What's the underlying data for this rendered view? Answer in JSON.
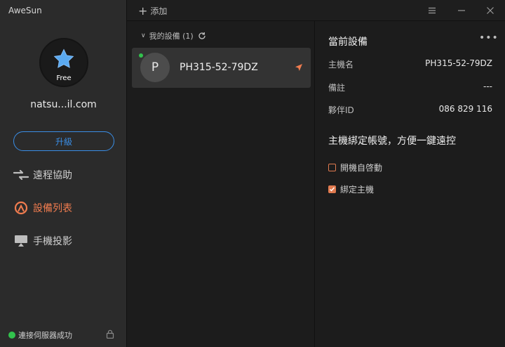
{
  "app": {
    "title": "AweSun"
  },
  "profile": {
    "badge": "Free",
    "email": "natsu...il.com"
  },
  "sidebar": {
    "upgrade_label": "升級",
    "items": [
      {
        "label": "遠程協助",
        "icon": "remote-assist-icon",
        "active": false
      },
      {
        "label": "設備列表",
        "icon": "device-list-icon",
        "active": true
      },
      {
        "label": "手機投影",
        "icon": "screen-cast-icon",
        "active": false
      }
    ],
    "status_text": "連接伺服器成功"
  },
  "toolbar": {
    "add_label": "添加"
  },
  "device_list": {
    "group_label": "我的設備 (1)",
    "devices": [
      {
        "initial": "P",
        "name": "PH315-52-79DZ",
        "online": true
      }
    ]
  },
  "details": {
    "title": "當前設備",
    "rows": [
      {
        "key": "主機名",
        "value": "PH315-52-79DZ"
      },
      {
        "key": "備註",
        "value": "---"
      },
      {
        "key": "夥伴ID",
        "value": "086 829 116"
      }
    ],
    "bind_title": "主機綁定帳號，方便一鍵遠控",
    "options": [
      {
        "label": "開機自啓動",
        "checked": false
      },
      {
        "label": "綁定主機",
        "checked": true
      }
    ]
  },
  "colors": {
    "accent": "#f07c4f",
    "link": "#3a8ee6",
    "online": "#32c24d"
  }
}
